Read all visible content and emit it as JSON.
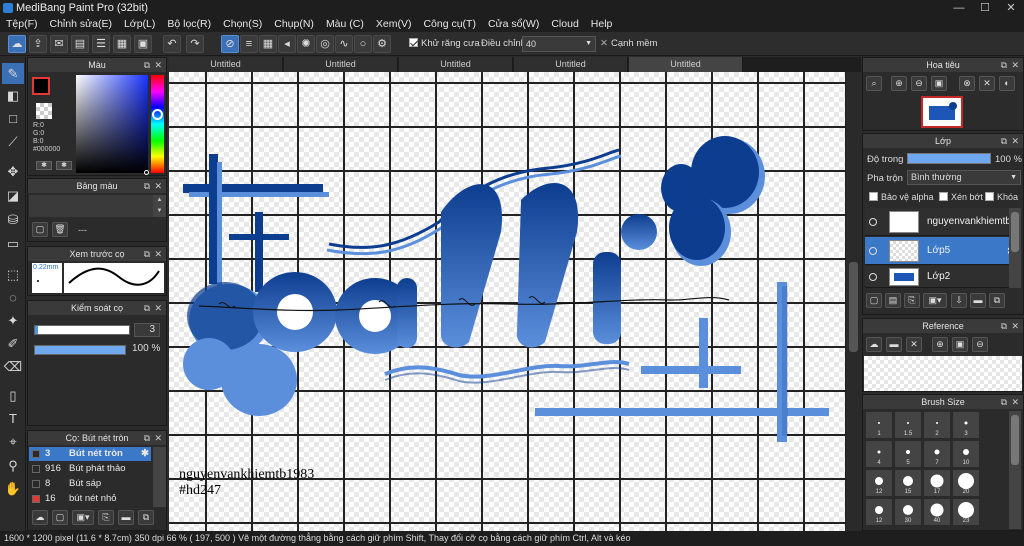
{
  "title": "MediBang Paint Pro (32bit)",
  "menu": [
    "Tệp(F)",
    "Chỉnh sửa(E)",
    "Lớp(L)",
    "Bộ lọc(R)",
    "Chọn(S)",
    "Chụp(N)",
    "Màu (C)",
    "Xem(V)",
    "Công cụ(T)",
    "Cửa sổ(W)",
    "Cloud",
    "Help"
  ],
  "toolbar": {
    "antialias_label": "Khử răng cưa",
    "adjust_label": "Điều chỉnh",
    "adjust_value": "40",
    "smooth_label": "Cạnh mềm"
  },
  "tabs": [
    "Untitled",
    "Untitled",
    "Untitled",
    "Untitled",
    "Untitled"
  ],
  "color_panel": {
    "title": "Màu",
    "r": "R:0",
    "g": "G:0",
    "b": "B:0",
    "hex": "#000000"
  },
  "palette_panel": {
    "title": "Bảng màu",
    "dash": "---"
  },
  "preview_panel": {
    "title": "Xem trước cọ",
    "size": "0.22mm"
  },
  "control_panel": {
    "title": "Kiểm soát cọ",
    "size": "3",
    "opacity": "100 %"
  },
  "brush_panel": {
    "title": "Cọ: Bút nét tròn",
    "items": [
      {
        "n": "3",
        "name": "Bút nét tròn",
        "color": "#2a2a2a"
      },
      {
        "n": "916",
        "name": "Bút phát thảo",
        "color": "#2a2a2a"
      },
      {
        "n": "8",
        "name": "Bút sáp",
        "color": "#2a2a2a"
      },
      {
        "n": "16",
        "name": "bút nét nhỏ",
        "color": "#e53935"
      }
    ]
  },
  "navigator": {
    "title": "Hoa tiêu"
  },
  "layer_panel": {
    "title": "Lớp",
    "opacity_label": "Độ trong",
    "opacity_value": "100 %",
    "blend_label": "Pha trộn",
    "blend_value": "Bình thường",
    "protect_alpha": "Bảo vệ alpha",
    "clip": "Xén bớt",
    "lock": "Khóa",
    "layers": [
      "nguyenvankhiemtb",
      "Lớp5",
      "Lớp2"
    ]
  },
  "reference": {
    "title": "Reference"
  },
  "brush_size": {
    "title": "Brush Size",
    "sizes": [
      "1",
      "1.5",
      "2",
      "3",
      "4",
      "5",
      "7",
      "10",
      "12",
      "15",
      "17",
      "20",
      "12",
      "30",
      "40",
      "23"
    ]
  },
  "canvas": {
    "signature1": "nguyenvankhiemtb1983",
    "signature2": "#hd247",
    "word": "calli"
  },
  "status": {
    "dims": "1600 * 1200 pixel",
    "cm": "(11.6 * 8.7cm)",
    "dpi": "350 dpi",
    "zoom": "66 %",
    "coord": "( 197, 500 )",
    "hint": "Vẽ một đường thẳng bằng cách giữ phím Shift, Thay đổi cỡ cọ bằng cách giữ phím Ctrl, Alt và kéo"
  },
  "colors": {
    "accent": "#3b6fb6",
    "art_dark": "#0d3d8f",
    "art_light": "#5b8fdc"
  }
}
